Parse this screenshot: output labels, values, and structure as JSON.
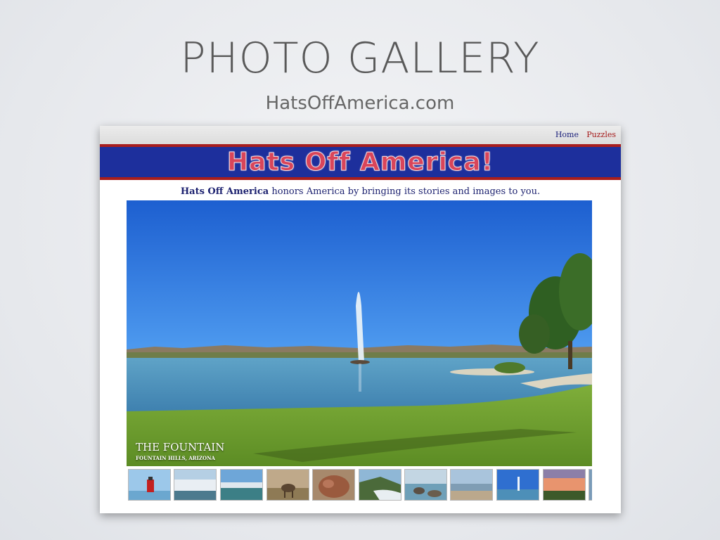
{
  "slide": {
    "title": "PHOTO GALLERY",
    "subtitle": "HatsOffAmerica.com"
  },
  "nav": {
    "home": "Home",
    "puzzles": "Puzzles"
  },
  "banner": {
    "title": "Hats Off America!"
  },
  "tagline": {
    "brand": "Hats Off America",
    "text": " honors America by bringing its stories and images to you."
  },
  "photo": {
    "title": "THE FOUNTAIN",
    "location": "FOUNTAIN HILLS, ARIZONA"
  },
  "thumbnails": [
    {
      "subject": "red-lighthouse"
    },
    {
      "subject": "waterfall"
    },
    {
      "subject": "falls-river"
    },
    {
      "subject": "elk"
    },
    {
      "subject": "red-rocks"
    },
    {
      "subject": "coast-waves"
    },
    {
      "subject": "rocky-shore"
    },
    {
      "subject": "beach"
    },
    {
      "subject": "fountain-lake"
    },
    {
      "subject": "sunset"
    }
  ],
  "colors": {
    "banner_blue": "#1d2f9c",
    "banner_red": "#a81e1e",
    "tagline_navy": "#1d2270"
  }
}
